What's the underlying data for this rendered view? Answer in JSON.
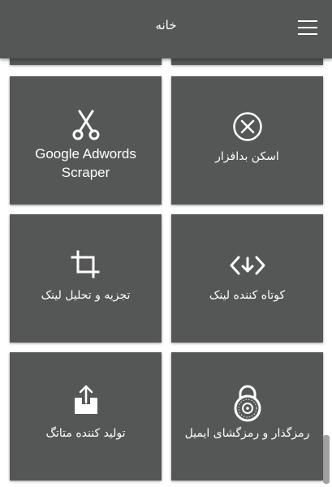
{
  "header": {
    "title": "خانه",
    "menu_icon": "hamburger-menu-icon",
    "background": "#555756"
  },
  "tiles": [
    {
      "label": "Google Adwords Scraper",
      "icon": "scissors-icon"
    },
    {
      "label": "اسکن بدافزار",
      "icon": "close-circle-icon"
    },
    {
      "label": "تجزیه و تحلیل لینک",
      "icon": "crop-icon"
    },
    {
      "label": "کوتاه کننده لینک",
      "icon": "code-arrow-icon"
    },
    {
      "label": "تولید کننده متاتگ",
      "icon": "upload-icon"
    },
    {
      "label": "رمزگذار و رمزگشای ایمیل",
      "icon": "combination-lock-icon"
    }
  ],
  "colors": {
    "tile": "#555756",
    "text": "#ffffff"
  }
}
